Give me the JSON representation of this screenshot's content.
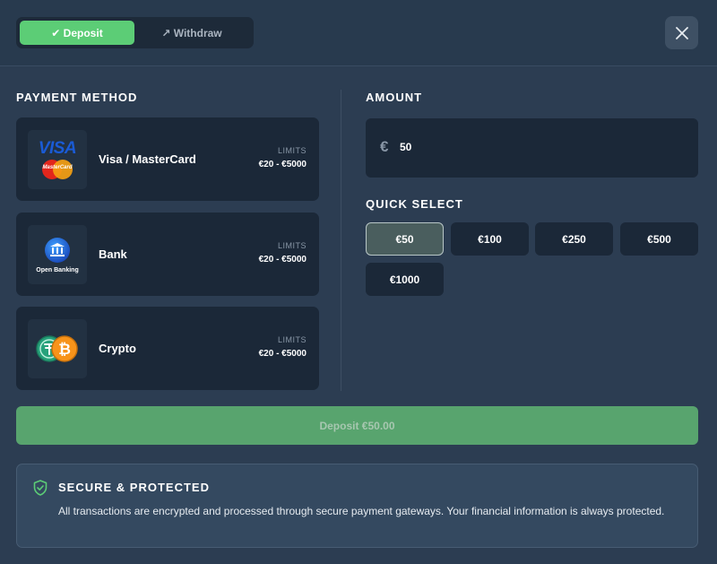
{
  "tabs": {
    "deposit": {
      "icon": "check-icon",
      "label": "✔ Deposit"
    },
    "withdraw": {
      "icon": "arrow-up-right-icon",
      "label": "↗ Withdraw"
    }
  },
  "payment_method": {
    "title": "PAYMENT METHOD",
    "methods": [
      {
        "name": "Visa / MasterCard",
        "limits_label": "LIMITS",
        "limits": "€20 - €5000",
        "logo_text": "VISA",
        "logo_sub": "MasterCard"
      },
      {
        "name": "Bank",
        "limits_label": "LIMITS",
        "limits": "€20 - €5000",
        "logo_sub": "Open Banking"
      },
      {
        "name": "Crypto",
        "limits_label": "LIMITS",
        "limits": "€20 - €5000"
      }
    ]
  },
  "amount": {
    "title": "AMOUNT",
    "currency": "€",
    "value": "50"
  },
  "quick_select": {
    "title": "QUICK SELECT",
    "options": [
      "€50",
      "€100",
      "€250",
      "€500",
      "€1000"
    ],
    "selected": "€50"
  },
  "deposit_button": {
    "label": "Deposit €50.00"
  },
  "secure": {
    "title": "SECURE & PROTECTED",
    "text": "All transactions are encrypted and processed through secure payment gateways. Your financial information is always protected."
  },
  "colors": {
    "accent": "#5ccd76",
    "background": "#2c3d52",
    "card": "#1b2838"
  }
}
